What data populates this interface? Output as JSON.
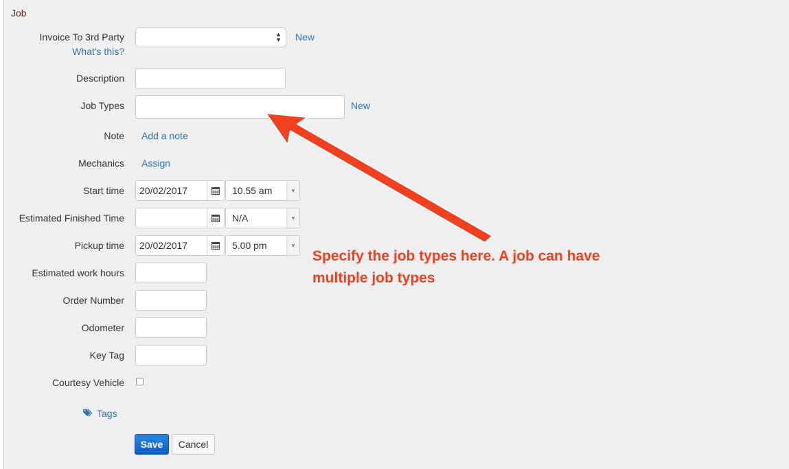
{
  "section": {
    "title": "Job"
  },
  "fields": {
    "invoice_third_party": {
      "label": "Invoice To 3rd Party",
      "help_link": "What's this?",
      "new_link": "New",
      "value": ""
    },
    "description": {
      "label": "Description",
      "value": ""
    },
    "job_types": {
      "label": "Job Types",
      "new_link": "New",
      "value": ""
    },
    "note": {
      "label": "Note",
      "link": "Add a note"
    },
    "mechanics": {
      "label": "Mechanics",
      "link": "Assign"
    },
    "start_time": {
      "label": "Start time",
      "date": "20/02/2017",
      "time": "10.55 am"
    },
    "estimated_finished_time": {
      "label": "Estimated Finished Time",
      "date": "",
      "time": "N/A"
    },
    "pickup_time": {
      "label": "Pickup time",
      "date": "20/02/2017",
      "time": "5.00 pm"
    },
    "estimated_work_hours": {
      "label": "Estimated work hours",
      "value": ""
    },
    "order_number": {
      "label": "Order Number",
      "value": ""
    },
    "odometer": {
      "label": "Odometer",
      "value": ""
    },
    "key_tag": {
      "label": "Key Tag",
      "value": ""
    },
    "courtesy_vehicle": {
      "label": "Courtesy Vehicle",
      "checked": false
    }
  },
  "tags": {
    "label": "Tags"
  },
  "actions": {
    "save": "Save",
    "cancel": "Cancel"
  },
  "annotation": {
    "line1": "Specify the job types here. A job can have",
    "line2": "multiple job types",
    "color": "#f0401f"
  },
  "colors": {
    "link": "#2a73b8",
    "section_title": "#6b1a1a",
    "save_button": "#1570d4"
  }
}
